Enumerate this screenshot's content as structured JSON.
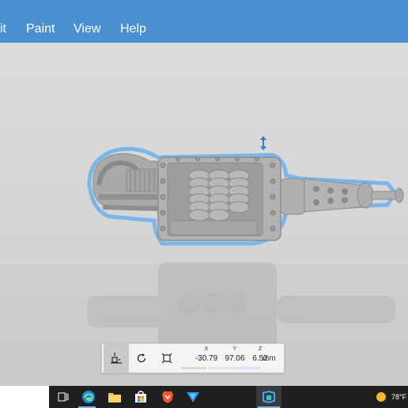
{
  "menu": {
    "items": [
      "it",
      "Paint",
      "View",
      "Help"
    ]
  },
  "toolbar": {
    "x_label": "X",
    "y_label": "Y",
    "z_label": "Z",
    "x_value": "-30.79",
    "y_value": "97.06",
    "z_value": "6.52",
    "unit": "mm",
    "buttons": [
      "drop-to-floor",
      "rotate",
      "fit-scale"
    ]
  },
  "taskbar": {
    "icons": [
      "task-view-icon",
      "edge-icon",
      "file-explorer-icon",
      "store-icon",
      "brave-icon",
      "app-triangle-icon",
      "paint3d-icon"
    ],
    "temperature": "78°F"
  },
  "colors": {
    "menubar": "#4a90d0",
    "selection": "#5aa8e8",
    "taskbar": "#1f1f1f"
  }
}
